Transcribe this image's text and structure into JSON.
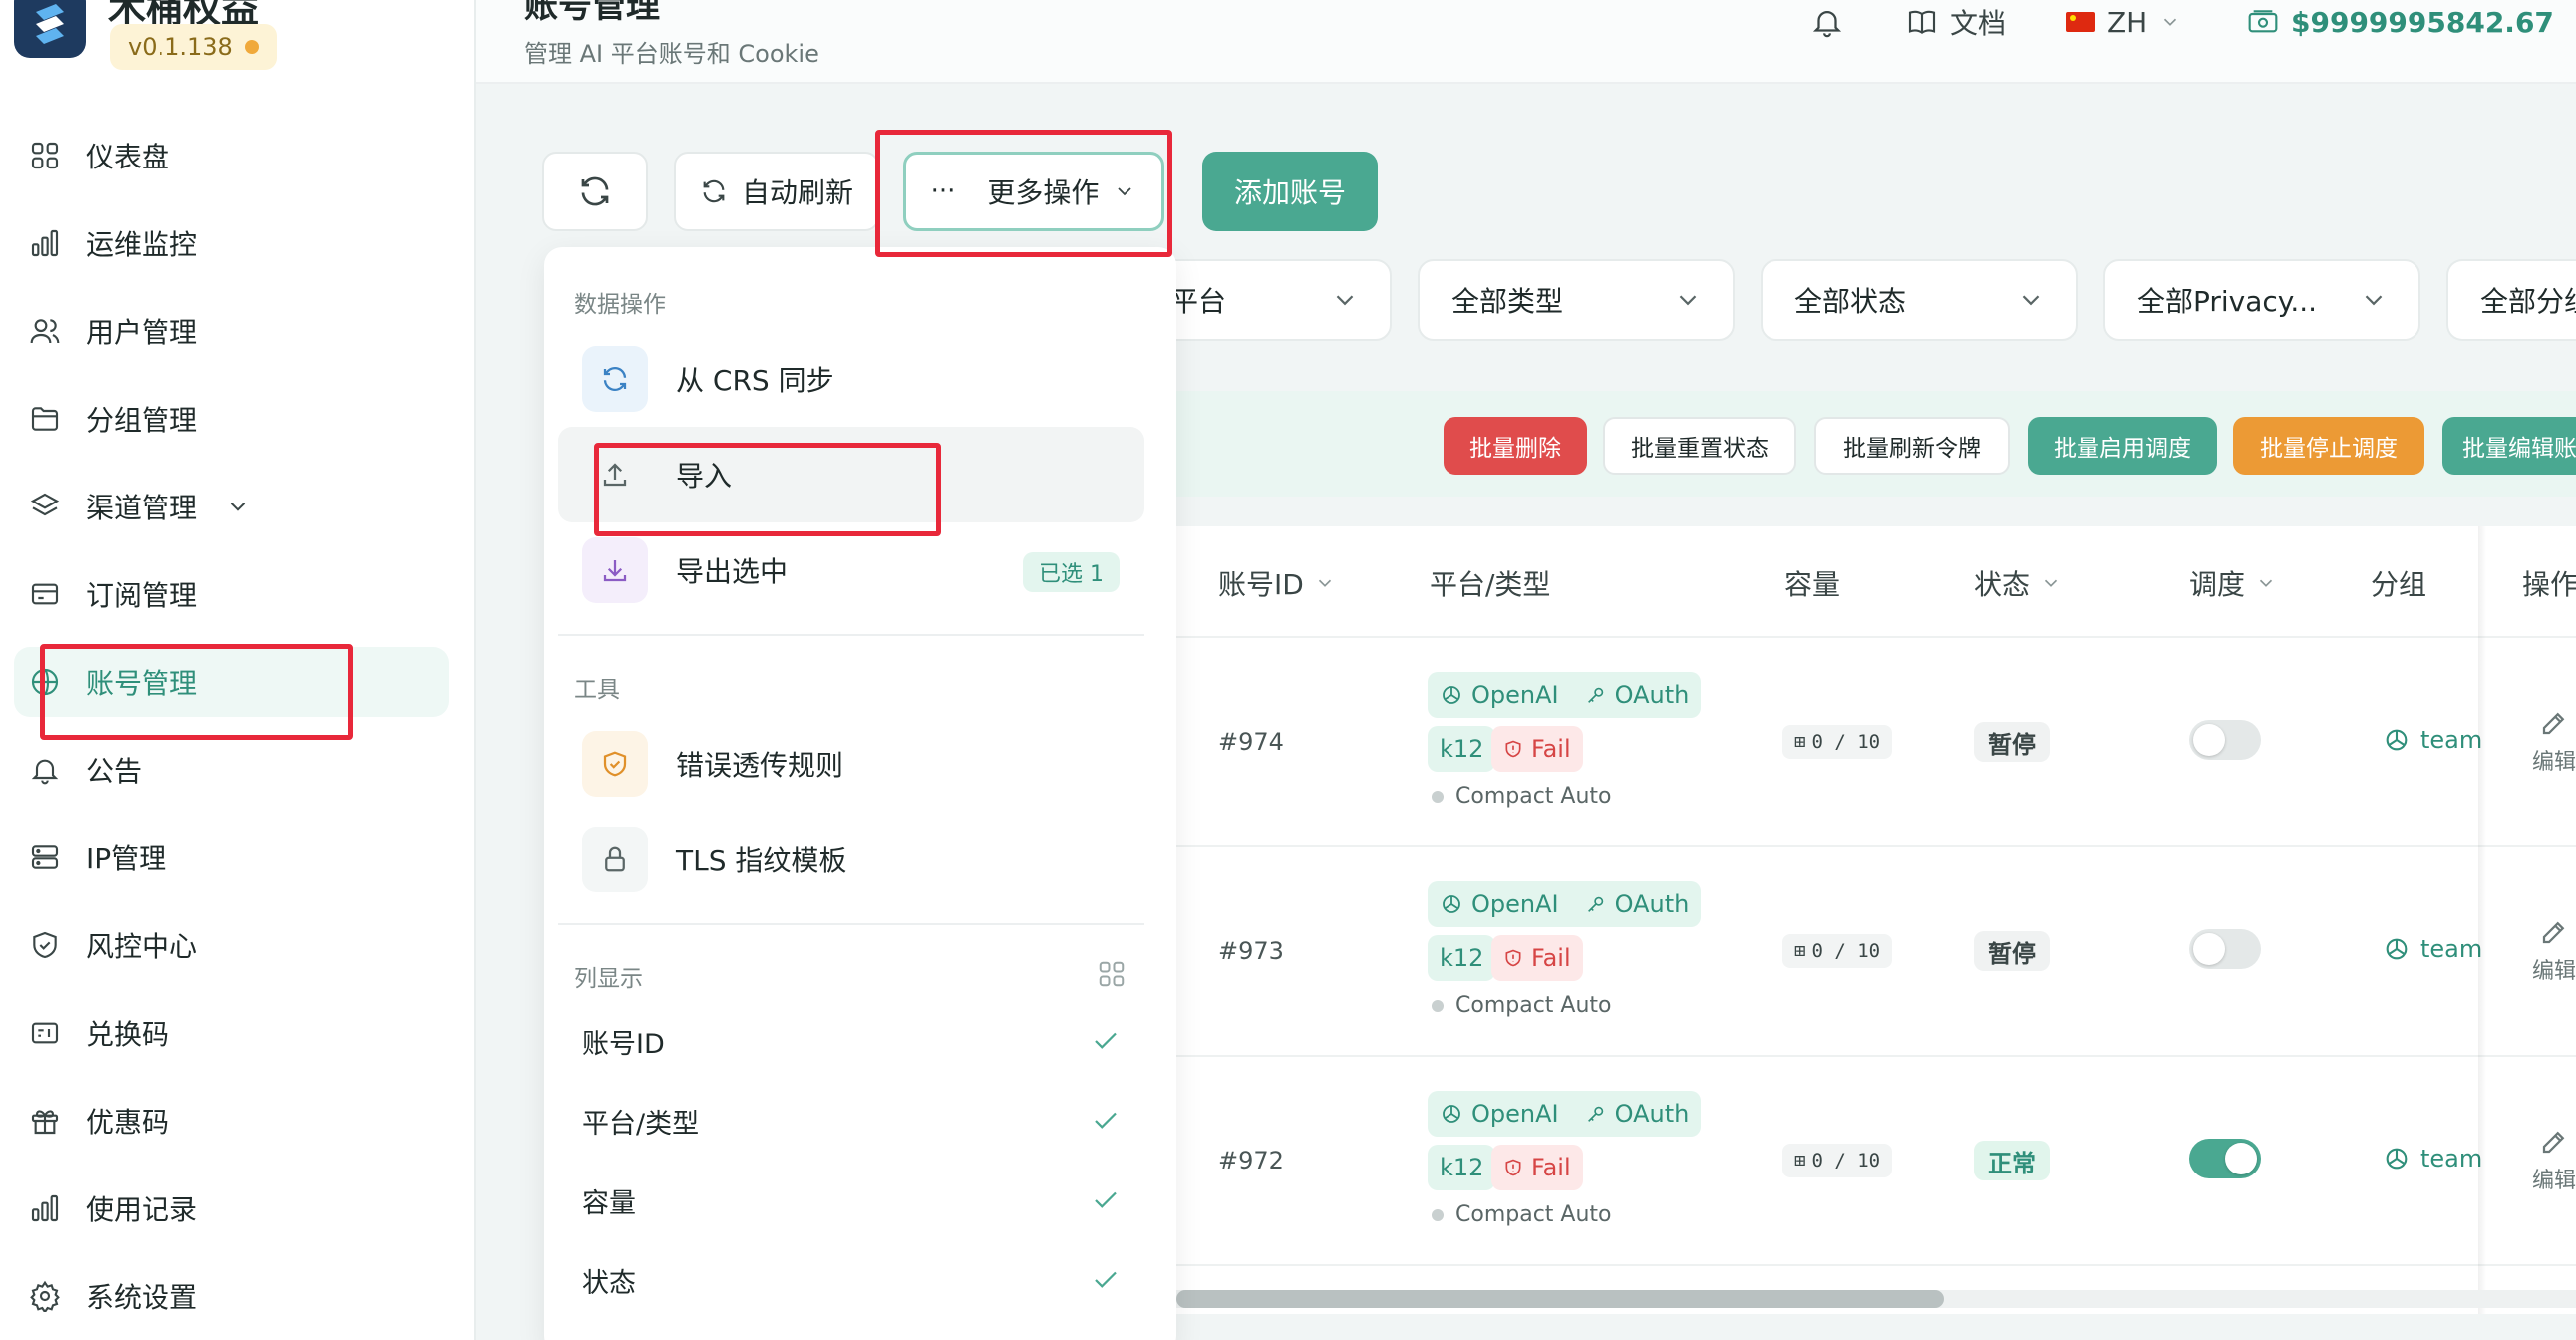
{
  "app": {
    "name": "木桶权益",
    "version": "v0.1.138",
    "status_color": "#f0a93b",
    "accent_color": "#4aa891"
  },
  "sidebar": {
    "items": [
      {
        "label": "仪表盘",
        "icon": "grid-icon"
      },
      {
        "label": "运维监控",
        "icon": "bar-chart-icon"
      },
      {
        "label": "用户管理",
        "icon": "users-icon"
      },
      {
        "label": "分组管理",
        "icon": "folder-icon"
      },
      {
        "label": "渠道管理",
        "icon": "layers-icon",
        "has_submenu": true
      },
      {
        "label": "订阅管理",
        "icon": "card-icon"
      },
      {
        "label": "账号管理",
        "icon": "globe-icon",
        "active": true
      },
      {
        "label": "公告",
        "icon": "bell-icon"
      },
      {
        "label": "IP管理",
        "icon": "server-icon"
      },
      {
        "label": "风控中心",
        "icon": "shield-icon"
      },
      {
        "label": "兑换码",
        "icon": "ticket-icon"
      },
      {
        "label": "优惠码",
        "icon": "gift-icon"
      },
      {
        "label": "使用记录",
        "icon": "bar-chart-icon"
      },
      {
        "label": "系统设置",
        "icon": "gear-icon"
      }
    ]
  },
  "header": {
    "title": "账号管理",
    "subtitle": "管理 AI 平台账号和 Cookie",
    "docs_label": "文档",
    "language": "ZH",
    "balance": "$9999995842.67"
  },
  "toolbar": {
    "auto_refresh_label": "自动刷新",
    "more_actions_label": "更多操作",
    "add_account_label": "添加账号"
  },
  "filters": {
    "platform": "平台",
    "type": "全部类型",
    "status": "全部状态",
    "privacy": "全部Privacy...",
    "group": "全部分组"
  },
  "batch_actions": {
    "delete": "批量删除",
    "reset_status": "批量重置状态",
    "refresh_token": "批量刷新令牌",
    "enable_schedule": "批量启用调度",
    "disable_schedule": "批量停止调度",
    "edit": "批量编辑账号"
  },
  "table": {
    "headers": {
      "id": "账号ID",
      "platform_type": "平台/类型",
      "capacity": "容量",
      "status": "状态",
      "schedule": "调度",
      "group": "分组",
      "actions": "操作"
    },
    "rows": [
      {
        "id": "#974",
        "platform": "OpenAI",
        "auth": "OAuth",
        "plan": "k12",
        "result": "Fail",
        "mode": "Compact Auto",
        "capacity": "0 / 10",
        "status": "暂停",
        "schedule_on": false,
        "group": "team",
        "edit": "编辑"
      },
      {
        "id": "#973",
        "platform": "OpenAI",
        "auth": "OAuth",
        "plan": "k12",
        "result": "Fail",
        "mode": "Compact Auto",
        "capacity": "0 / 10",
        "status": "暂停",
        "schedule_on": false,
        "group": "team",
        "edit": "编辑"
      },
      {
        "id": "#972",
        "platform": "OpenAI",
        "auth": "OAuth",
        "plan": "k12",
        "result": "Fail",
        "mode": "Compact Auto",
        "capacity": "0 / 10",
        "status": "正常",
        "schedule_on": true,
        "group": "team",
        "edit": "编辑"
      }
    ]
  },
  "dropdown": {
    "data_section": "数据操作",
    "sync_crs": "从 CRS 同步",
    "import": "导入",
    "export_selected": "导出选中",
    "selected_count": "已选 1",
    "tools_section": "工具",
    "error_rules": "错误透传规则",
    "tls_template": "TLS 指纹模板",
    "columns_section": "列显示",
    "columns": [
      {
        "label": "账号ID",
        "checked": true
      },
      {
        "label": "平台/类型",
        "checked": true
      },
      {
        "label": "容量",
        "checked": true
      },
      {
        "label": "状态",
        "checked": true
      }
    ]
  }
}
